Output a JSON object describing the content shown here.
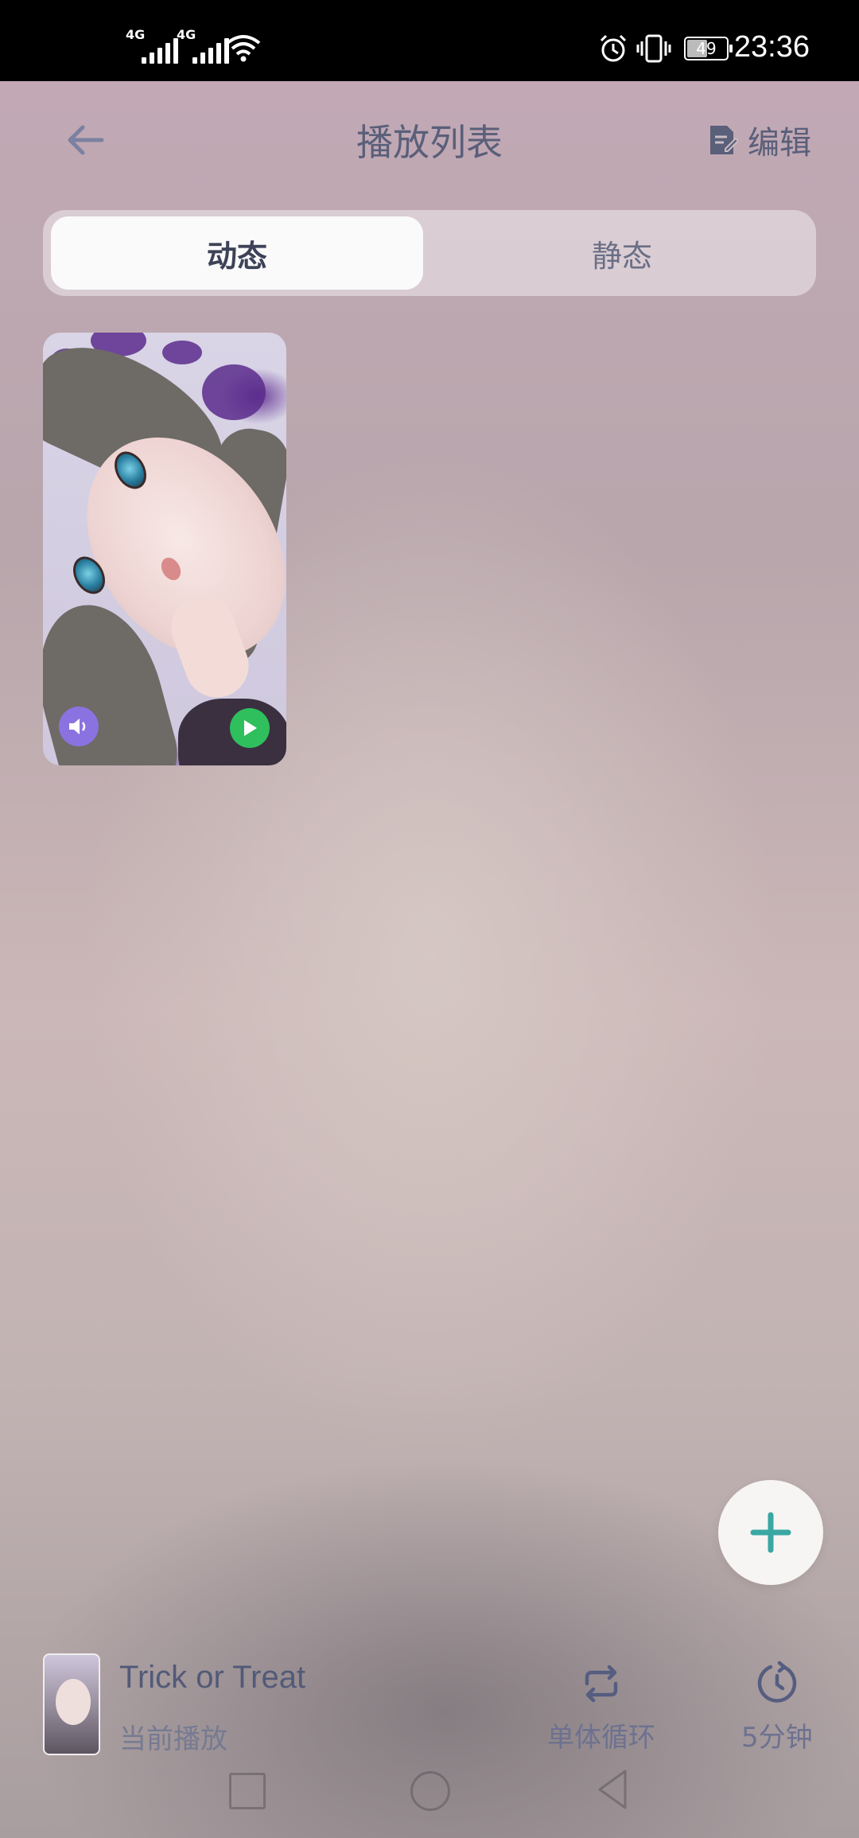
{
  "status_bar": {
    "signal1_label": "4G",
    "signal2_label": "4G",
    "battery_level": "49",
    "time": "23:36"
  },
  "header": {
    "title": "播放列表",
    "edit_label": "编辑"
  },
  "tabs": [
    {
      "label": "动态",
      "active": true
    },
    {
      "label": "静态",
      "active": false
    }
  ],
  "now_playing": {
    "title": "Trick or Treat",
    "subtitle": "当前播放",
    "loop_mode_label": "单体循环",
    "timer_label": "5分钟"
  },
  "colors": {
    "accent_teal": "#3aa7a3",
    "play_green": "#2fbf5c",
    "sound_purple": "#8a73e0",
    "text_primary": "#5a5f7a"
  }
}
